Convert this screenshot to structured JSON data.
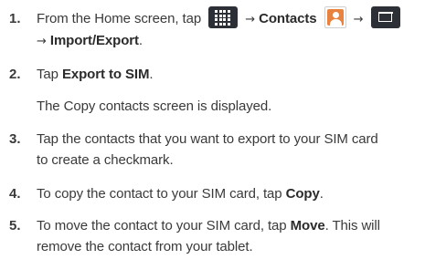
{
  "steps": [
    {
      "number": "1.",
      "prefix": "From the Home screen, tap",
      "arrow1": "→",
      "contacts": "Contacts",
      "arrow2": "→",
      "arrow3": "→",
      "import_export": "Import/Export",
      "suffix": "."
    },
    {
      "number": "2.",
      "prefix": "Tap",
      "bold": "Export to SIM",
      "suffix": ".",
      "note": "The Copy contacts screen is displayed."
    },
    {
      "number": "3.",
      "line1": "Tap the contacts that you want to export to your SIM card",
      "line2": "to create a checkmark."
    },
    {
      "number": "4.",
      "prefix": "To copy the contact to your SIM card, tap",
      "bold": "Copy",
      "suffix": "."
    },
    {
      "number": "5.",
      "prefix": "To move the contact to your SIM card, tap",
      "bold": "Move",
      "suffix": ". This will",
      "line2": "remove the contact from your tablet."
    }
  ],
  "icons": {
    "apps": "apps-grid-icon",
    "contacts": "contacts-app-icon",
    "menu": "menu-icon"
  },
  "colors": {
    "text": "#3a3a3a",
    "icon_dark": "#2c2f36",
    "contacts_orange": "#e9823e"
  }
}
